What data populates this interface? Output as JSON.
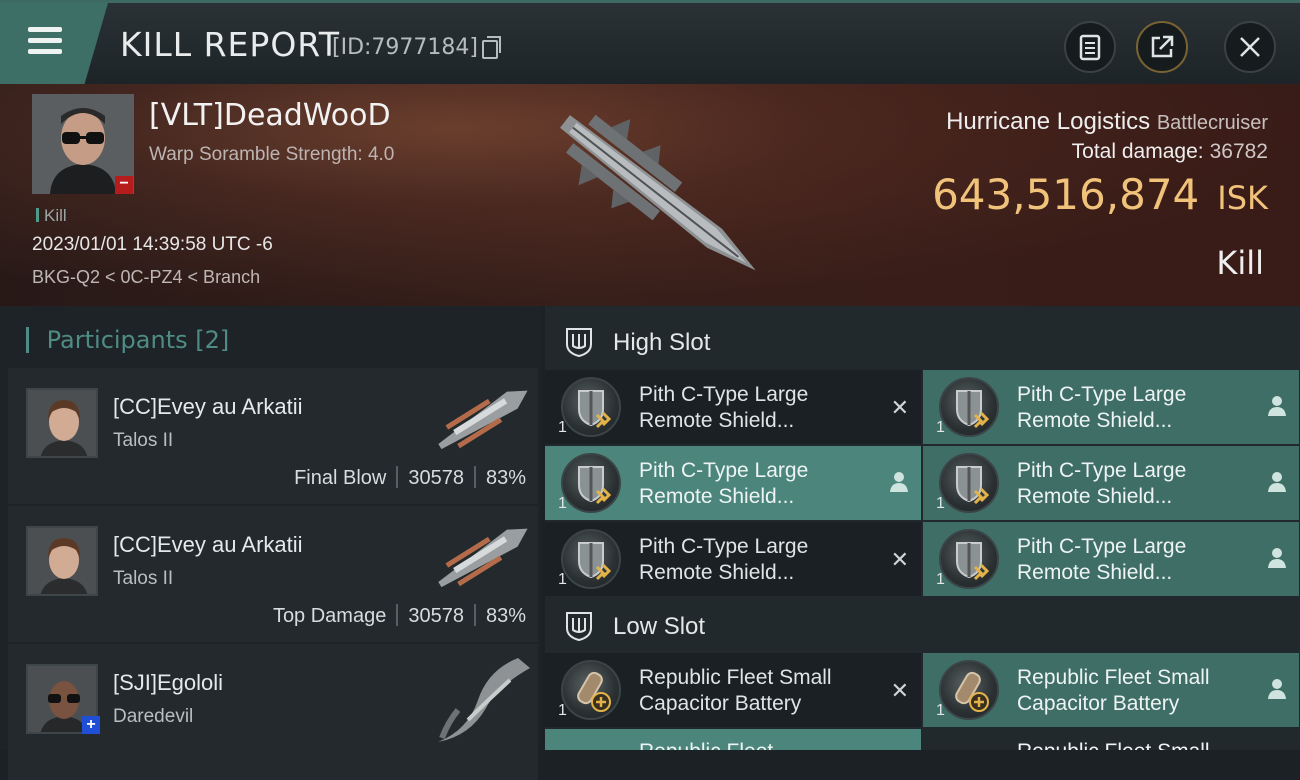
{
  "header": {
    "title": "KILL REPORT",
    "kill_id": "[ID:7977184]"
  },
  "victim": {
    "name": "[VLT]DeadWooD",
    "detail": "Warp Soramble Strength: 4.0",
    "tag": "Kill",
    "datetime": "2023/01/01 14:39:58 UTC -6",
    "location": "BKG-Q2 < 0C-PZ4 < Branch",
    "ship_name": "Hurricane Logistics",
    "ship_class": "Battlecruiser",
    "total_damage_label": "Total damage:",
    "total_damage": "36782",
    "isk_value": "643,516,874",
    "isk_unit": "ISK",
    "result": "Kill"
  },
  "participants": {
    "label": "Participants",
    "count": "[2]",
    "rows": [
      {
        "name": "[CC]Evey au Arkatii",
        "ship": "Talos II",
        "role": "Final Blow",
        "damage": "30578",
        "pct": "83%"
      },
      {
        "name": "[CC]Evey au Arkatii",
        "ship": "Talos II",
        "role": "Top Damage",
        "damage": "30578",
        "pct": "83%"
      },
      {
        "name": "[SJI]Egololi",
        "ship": "Daredevil"
      }
    ]
  },
  "slots": {
    "high": {
      "label": "High Slot",
      "items": [
        {
          "line1": "Pith C-Type Large",
          "line2": "Remote Shield...",
          "qty": "1",
          "status": "destroyed"
        },
        {
          "line1": "Pith C-Type Large",
          "line2": "Remote Shield...",
          "qty": "1",
          "status": "dropped"
        },
        {
          "line1": "Pith C-Type Large",
          "line2": "Remote Shield...",
          "qty": "1",
          "status": "dropped"
        },
        {
          "line1": "Pith C-Type Large",
          "line2": "Remote Shield...",
          "qty": "1",
          "status": "dropped"
        },
        {
          "line1": "Pith C-Type Large",
          "line2": "Remote Shield...",
          "qty": "1",
          "status": "destroyed"
        },
        {
          "line1": "Pith C-Type Large",
          "line2": "Remote Shield...",
          "qty": "1",
          "status": "dropped"
        }
      ]
    },
    "low": {
      "label": "Low Slot",
      "items": [
        {
          "line1": "Republic Fleet Small",
          "line2": "Capacitor Battery",
          "qty": "1",
          "status": "destroyed"
        },
        {
          "line1": "Republic Fleet Small",
          "line2": "Capacitor Battery",
          "qty": "1",
          "status": "dropped"
        },
        {
          "line1": "Republic Fleet",
          "line2": "",
          "qty": "",
          "status": "dropped"
        },
        {
          "line1": "Republic Fleet Small",
          "line2": "",
          "qty": "",
          "status": "destroyed"
        }
      ]
    }
  },
  "icons": {
    "menu": "hamburger-menu-icon",
    "copy": "copy-icon",
    "clipboard": "clipboard-icon",
    "share": "share-icon",
    "close": "close-icon",
    "slot": "slot-shield-icon",
    "destroyed": "x-icon",
    "dropped": "person-icon"
  },
  "colors": {
    "accent": "#4b857c",
    "isk": "#f0c27a",
    "victim_badge": "#b71c1c",
    "friendly_badge": "#1f4fd6"
  }
}
